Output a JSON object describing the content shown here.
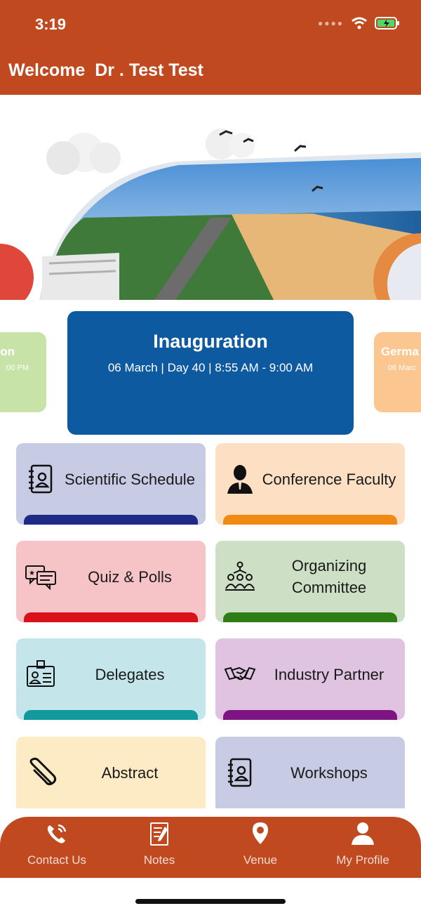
{
  "status": {
    "time": "3:19"
  },
  "header": {
    "welcome": "Welcome  Dr . Test Test"
  },
  "carousel": {
    "left": {
      "title": "on",
      "subtitle": ":00 PM"
    },
    "main": {
      "title": "Inauguration",
      "subtitle": "06 March | Day 40 | 8:55 AM - 9:00 AM"
    },
    "right": {
      "title": "Germa",
      "subtitle": "06 Marc"
    }
  },
  "tiles": [
    {
      "label": "Scientific Schedule",
      "bg": "#c7cbe3",
      "bar": "#1e2a86",
      "icon": "address-book-icon"
    },
    {
      "label": "Conference Faculty",
      "bg": "#fde0c4",
      "bar": "#f08a12",
      "icon": "person-icon"
    },
    {
      "label": "Quiz & Polls",
      "bg": "#f6c4c7",
      "bar": "#d9121a",
      "icon": "chat-bubbles-icon"
    },
    {
      "label": "Organizing Committee",
      "bg": "#cde0c5",
      "bar": "#2e7d16",
      "icon": "team-icon"
    },
    {
      "label": "Delegates",
      "bg": "#c4e6ea",
      "bar": "#119a9e",
      "icon": "id-badge-icon"
    },
    {
      "label": "Industry Partner",
      "bg": "#dfc3e1",
      "bar": "#7e1482",
      "icon": "handshake-icon"
    },
    {
      "label": "Abstract",
      "bg": "#fdebc5",
      "bar": "#f2b400",
      "icon": "paperclip-icon"
    },
    {
      "label": "Workshops",
      "bg": "#c7cbe3",
      "bar": "#1e2a86",
      "icon": "address-book-icon"
    }
  ],
  "nav": [
    {
      "label": "Contact Us",
      "icon": "phone-icon"
    },
    {
      "label": "Notes",
      "icon": "notes-icon"
    },
    {
      "label": "Venue",
      "icon": "location-pin-icon"
    },
    {
      "label": "My Profile",
      "icon": "profile-icon"
    }
  ],
  "colors": {
    "brand": "#c1491f",
    "highlight": "#0e5aa1"
  }
}
